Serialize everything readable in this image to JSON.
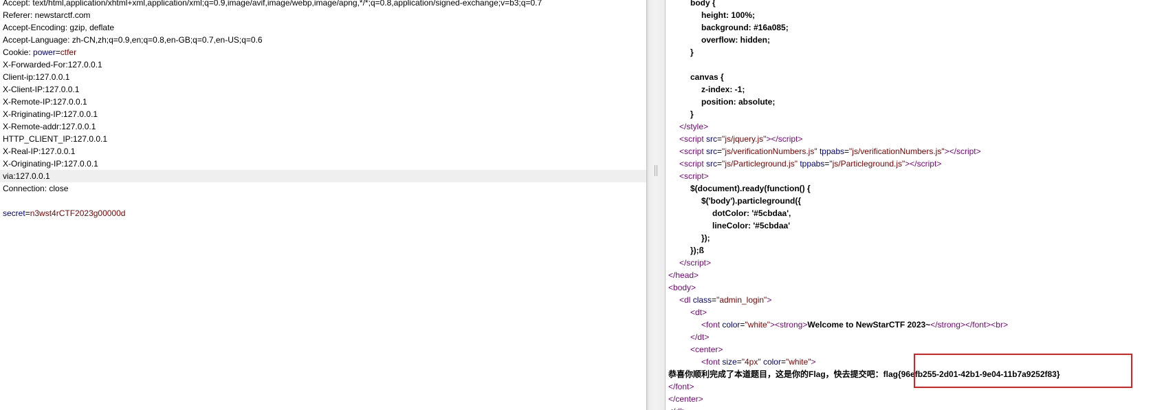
{
  "request": {
    "lines": [
      {
        "text": "Accept: text/html,application/xhtml+xml,application/xml;q=0.9,image/avif,image/webp,image/apng,*/*;q=0.8,application/signed-exchange;v=b3;q=0.7"
      },
      {
        "text": "Referer: newstarctf.com"
      },
      {
        "text": "Accept-Encoding: gzip, deflate"
      },
      {
        "text": "Accept-Language: zh-CN,zh;q=0.9,en;q=0.8,en-GB;q=0.7,en-US;q=0.6"
      },
      {
        "prefix": "Cookie: ",
        "key": "power",
        "sep": "=",
        "val": "ctfer"
      },
      {
        "text": "X-Forwarded-For:127.0.0.1"
      },
      {
        "text": "Client-ip:127.0.0.1"
      },
      {
        "text": "X-Client-IP:127.0.0.1"
      },
      {
        "text": "X-Remote-IP:127.0.0.1"
      },
      {
        "text": "X-Rriginating-IP:127.0.0.1"
      },
      {
        "text": "X-Remote-addr:127.0.0.1"
      },
      {
        "text": "HTTP_CLIENT_IP:127.0.0.1"
      },
      {
        "text": "X-Real-IP:127.0.0.1"
      },
      {
        "text": "X-Originating-IP:127.0.0.1"
      },
      {
        "text": "via:127.0.0.1"
      },
      {
        "text": "Connection: close"
      },
      {
        "text": ""
      },
      {
        "prefix": "",
        "key": "secret",
        "sep": "=",
        "val": "n3wst4rCTF2023g00000d"
      }
    ]
  },
  "response": {
    "css": {
      "body_open": "body {",
      "height": "height: 100%;",
      "background": "background: #16a085;",
      "overflow": "overflow: hidden;",
      "close": "}",
      "canvas_open": "canvas {",
      "zindex": "z-index: -1;",
      "position": "position: absolute;"
    },
    "style_close": "style",
    "scripts": [
      {
        "src": "js/jquery.js"
      },
      {
        "src": "js/verificationNumbers.js",
        "tppabs": "js/verificationNumbers.js"
      },
      {
        "src": "js/Particleground.js",
        "tppabs": "js/Particleground.js"
      }
    ],
    "js": {
      "l1": "$(document).ready(function() {",
      "l2": "$('body').particleground({",
      "l3": "dotColor: '#5cbdaa',",
      "l4": "lineColor: '#5cbdaa'",
      "l5": "});",
      "l6": "});ß"
    },
    "tags": {
      "style": "style",
      "script": "script",
      "head": "head",
      "body": "body",
      "dl": "dl",
      "dt": "dt",
      "font": "font",
      "strong": "strong",
      "br": "br",
      "center": "center"
    },
    "attrs": {
      "src": "src",
      "tppabs": "tppabs",
      "class": "class",
      "color": "color",
      "size": "size"
    },
    "dl_class": "admin_login",
    "font_color": "white",
    "font_size": "4px",
    "welcome": "Welcome to NewStarCTF 2023~",
    "congrats": "恭喜你顺利完成了本道题目，这是你的Flag，快去提交吧：",
    "flag": "flag{96efb255-2d01-42b1-9e04-11b7a9252f83}"
  },
  "colors": {
    "highlight_box": "#e02020"
  }
}
